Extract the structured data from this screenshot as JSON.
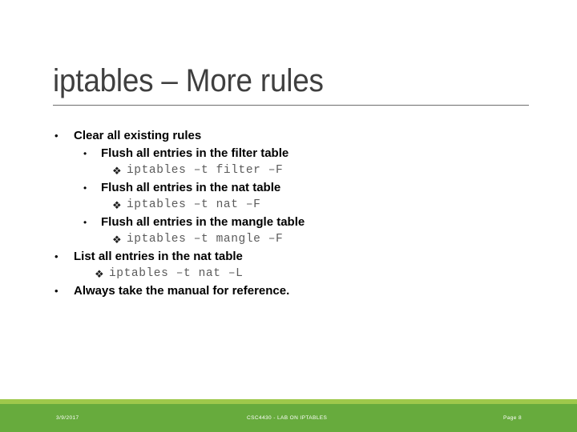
{
  "slide": {
    "title": "iptables – More rules",
    "background_color": "#ffffff",
    "title_color": "#3f3f3f",
    "rule_color": "#6e6e6e"
  },
  "bullets": [
    {
      "level": 1,
      "glyph": "•",
      "text": "Clear all existing rules"
    },
    {
      "level": 2,
      "glyph": "•",
      "text": "Flush all entries in the filter table"
    },
    {
      "level": 3,
      "glyph": "❖",
      "text": "iptables –t filter –F"
    },
    {
      "level": 2,
      "glyph": "•",
      "text": "Flush all entries in the nat table"
    },
    {
      "level": 3,
      "glyph": "❖",
      "text": "iptables –t nat –F"
    },
    {
      "level": 2,
      "glyph": "•",
      "text": "Flush all entries in the mangle table"
    },
    {
      "level": 3,
      "glyph": "❖",
      "text": "iptables –t mangle –F"
    },
    {
      "level": 1,
      "glyph": "•",
      "text": "List all entries in the nat table"
    },
    {
      "level": 3,
      "glyph": "❖",
      "text": "iptables –t nat –L",
      "shallow": true
    },
    {
      "level": 1,
      "glyph": "•",
      "text": "Always take the manual for reference."
    }
  ],
  "footer": {
    "date": "3/9/2017",
    "center": "CSC4430 - LAB ON IPTABLES",
    "page": "Page 8",
    "strip_color": "#9ec84b",
    "band_color": "#67ab3d",
    "text_color": "#ffffff"
  }
}
